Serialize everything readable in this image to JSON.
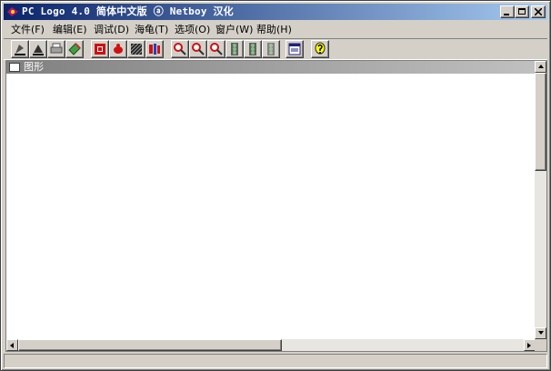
{
  "window": {
    "title": "PC Logo 4.0 简体中文版 ⓐ Netboy 汉化",
    "controls": {
      "minimize": "_",
      "maximize": "□",
      "close": "×"
    }
  },
  "menu": [
    {
      "label": "文件(F)"
    },
    {
      "label": "编辑(E)"
    },
    {
      "label": "调试(D)"
    },
    {
      "label": "海龟(T)"
    },
    {
      "label": "选项(O)"
    },
    {
      "label": "窗户(W)"
    },
    {
      "label": "帮助(H)"
    }
  ],
  "toolbar_icons": [
    "open-icon",
    "save-icon",
    "print-icon",
    "edit-icon",
    "stop-icon",
    "turtle-icon",
    "pattern-icon",
    "turtle-color-icon",
    "zoom-in-icon",
    "zoom-out-icon",
    "zoom-reset-icon",
    "traffic-light-icon",
    "traffic-light-step-icon",
    "traffic-light-off-icon",
    "window-icon",
    "help-icon"
  ],
  "child_window": {
    "title": "图形"
  },
  "status": {
    "text": ""
  },
  "colors": {
    "titlebar_start": "#0a246a",
    "titlebar_end": "#a6caf0",
    "child_title_start": "#808080",
    "child_title_end": "#c0c0c0"
  }
}
